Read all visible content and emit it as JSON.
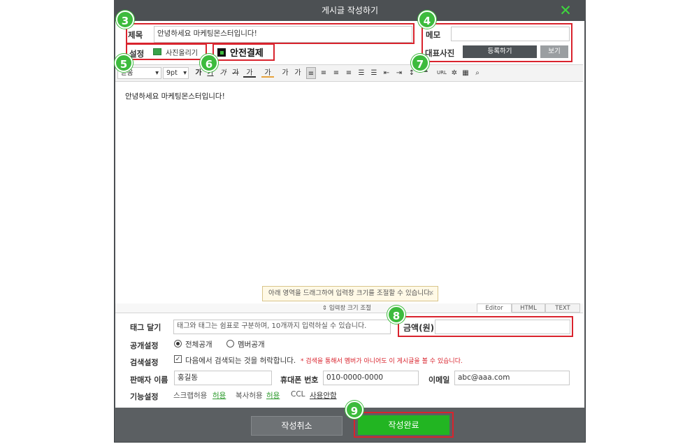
{
  "window": {
    "title": "게시글 작성하기"
  },
  "badges": {
    "b3": "3",
    "b4": "4",
    "b5": "5",
    "b6": "6",
    "b7": "7",
    "b8": "8",
    "b9": "9"
  },
  "subject": {
    "label": "제목",
    "value": "안녕하세요 마케팅몬스터입니다!"
  },
  "memo": {
    "label": "메모",
    "value": ""
  },
  "settings": {
    "label": "설정",
    "photo_upload": "사진올리기",
    "safe_payment": "안전결제"
  },
  "cover_photo": {
    "label": "대표사진",
    "register": "등록하기",
    "view": "보기"
  },
  "toolbar": {
    "font": "돋움",
    "size": "9pt",
    "bold": "가",
    "underline": "가",
    "italic": "가",
    "strike": "가",
    "font_color": "가",
    "highlight": "가",
    "superscript": "가",
    "subscript": "가",
    "quote": "❝",
    "url": "URL"
  },
  "editor": {
    "content": "안녕하세요 마케팅몬스터입니다!",
    "resize_hint": "아래 영역을 드래그하여 입력창 크기를 조절할 수 있습니다.",
    "resize_handle": "⇕ 입력창 크기 조절",
    "tabs": [
      "Editor",
      "HTML",
      "TEXT"
    ]
  },
  "tags": {
    "label": "태그 달기",
    "placeholder": "태그와 태그는 쉼표로 구분하며, 10개까지 입력하실 수 있습니다."
  },
  "price": {
    "label": "금액(원)",
    "value": ""
  },
  "visibility": {
    "label": "공개설정",
    "options": [
      "전체공개",
      "멤버공개"
    ],
    "selected": "전체공개"
  },
  "search": {
    "label": "검색설정",
    "checkbox_label": "다음에서 검색되는 것을 허락합니다.",
    "note": "* 검색을 통해서 멤버가 아니어도 이 게시글을 볼 수 있습니다."
  },
  "seller": {
    "label": "판매자 이름",
    "value": "홍길동"
  },
  "phone": {
    "label": "휴대폰 번호",
    "value": "010-0000-0000"
  },
  "email": {
    "label": "이메일",
    "value": "abc@aaa.com"
  },
  "features": {
    "label": "기능설정",
    "scrap_label": "스크랩허용",
    "scrap_value": "허용",
    "copy_label": "복사허용",
    "copy_value": "허용",
    "ccl_label": "CCL",
    "ccl_value": "사용안함"
  },
  "footer": {
    "cancel": "작성취소",
    "submit": "작성완료"
  }
}
